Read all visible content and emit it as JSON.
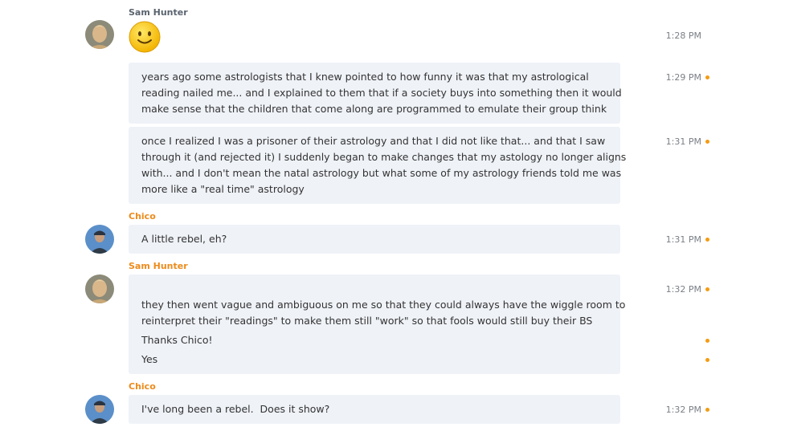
{
  "colors": {
    "sender_sam": "#59636e",
    "sender_chico": "#ed8b1c",
    "bubble": "#eff2f7",
    "unread_dot": "#f39c12",
    "timestamp": "#7a7f86"
  },
  "messages": [
    {
      "sender": "Sam Hunter",
      "emoji": "smiley-emoji",
      "time": "1:28 PM"
    },
    {
      "text": "years ago some astrologists that I knew pointed to how funny it was that my astrological",
      "time": "1:29 PM"
    },
    {
      "text": "reading nailed me... and I explained to them that if a society buys into something then it would"
    },
    {
      "text": "make sense that the children that come along are programmed to emulate their group think"
    },
    {
      "text": "once I realized I was a prisoner of their astrology and that I did not like that... and that I saw",
      "time": "1:31 PM"
    },
    {
      "text": "through it (and rejected it) I suddenly began to make changes that my astology no longer aligns"
    },
    {
      "text": "with... and I don't mean the natal astrology but what some of my astrology friends told me was"
    },
    {
      "text": "more like a \"real time\" astrology"
    },
    {
      "sender": "Chico",
      "text": "A little rebel, eh?",
      "time": "1:31 PM"
    },
    {
      "sender": "Sam Hunter",
      "time": "1:32 PM"
    },
    {
      "text": "they then went vague and ambiguous on me so that they could always have the wiggle room to"
    },
    {
      "text": "reinterpret their \"readings\" to make them still \"work\" so that fools would still buy their BS"
    },
    {
      "text": "Thanks Chico!"
    },
    {
      "text": "Yes"
    },
    {
      "sender": "Chico",
      "text": "I've long been a rebel.  Does it show?",
      "time": "1:32 PM"
    }
  ]
}
